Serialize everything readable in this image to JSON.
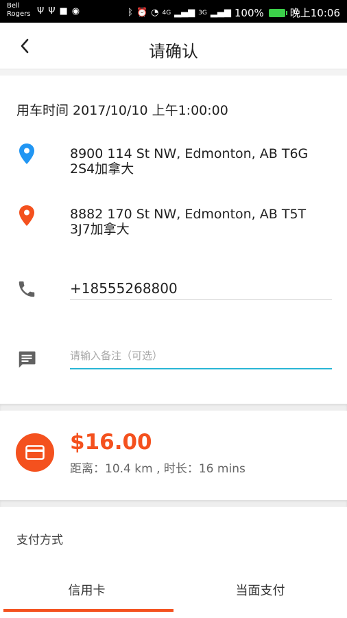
{
  "status_bar": {
    "carrier_line1": "Bell",
    "carrier_line2": "Rogers",
    "network": "4G",
    "network2": "3G",
    "battery": "100%",
    "time": "晚上10:06"
  },
  "header": {
    "title": "请确认"
  },
  "trip": {
    "ride_time": "用车时间 2017/10/10 上午1:00:00",
    "pickup_line1": "8900 114 St NW, Edmonton, AB T6G",
    "pickup_line2": "2S4加拿大",
    "dropoff_line1": "8882 170 St NW, Edmonton, AB T5T",
    "dropoff_line2": "3J7加拿大",
    "phone": "+18555268800",
    "note_placeholder": "请输入备注（可选）"
  },
  "fare": {
    "amount": "$16.00",
    "detail": "距离：10.4 km , 时长：16 mins"
  },
  "payment": {
    "label": "支付方式",
    "tabs": [
      {
        "label": "信用卡",
        "selected": true
      },
      {
        "label": "当面支付",
        "selected": false
      }
    ]
  },
  "colors": {
    "accent": "#f4511e",
    "pickup_pin": "#2196f3",
    "dropoff_pin": "#f4511e",
    "input_focus": "#29b6d6"
  }
}
